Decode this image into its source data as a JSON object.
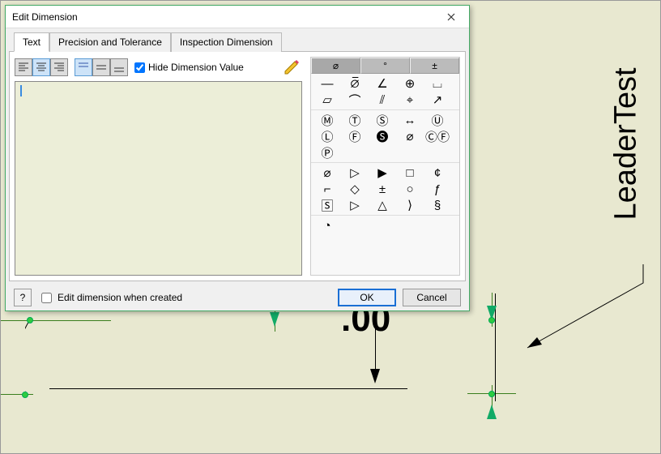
{
  "canvas": {
    "rotated_label": "LeaderTest",
    "dim_partial_text": ".00"
  },
  "dialog": {
    "title": "Edit Dimension",
    "tabs": [
      "Text",
      "Precision and Tolerance",
      "Inspection Dimension"
    ],
    "active_tab": 0,
    "toolbar": {
      "align_buttons": [
        "align-left",
        "align-center",
        "align-right"
      ],
      "valign_buttons": [
        "valign-top",
        "valign-middle",
        "valign-bottom"
      ],
      "hide_checkbox_label": "Hide Dimension Value",
      "hide_checked": true
    },
    "textarea_value": "",
    "right_tabs": [
      "⌀",
      "°",
      "±"
    ],
    "right_active": 0,
    "symbol_groups": [
      [
        "—",
        "⦱",
        "∠",
        "⊕",
        "⌴",
        "▱",
        "⌒",
        "⫽",
        "⌖",
        "↗"
      ],
      [
        "Ⓜ",
        "Ⓣ",
        "Ⓢ",
        "↔",
        "Ⓤ",
        "Ⓛ",
        "Ⓕ",
        "🅢",
        "⌀",
        "ⒸⒻ",
        "Ⓟ"
      ],
      [
        "⌀",
        "▷",
        "▶",
        "□",
        "¢",
        "⌐",
        "◇",
        "±",
        "○",
        "ƒ",
        "🅂",
        "▷",
        "△",
        "⟩",
        "§"
      ],
      [
        "◔"
      ]
    ],
    "footer": {
      "help_icon": "?",
      "edit_when_created_label": "Edit dimension when created",
      "edit_when_created_checked": false,
      "ok_label": "OK",
      "cancel_label": "Cancel"
    }
  }
}
